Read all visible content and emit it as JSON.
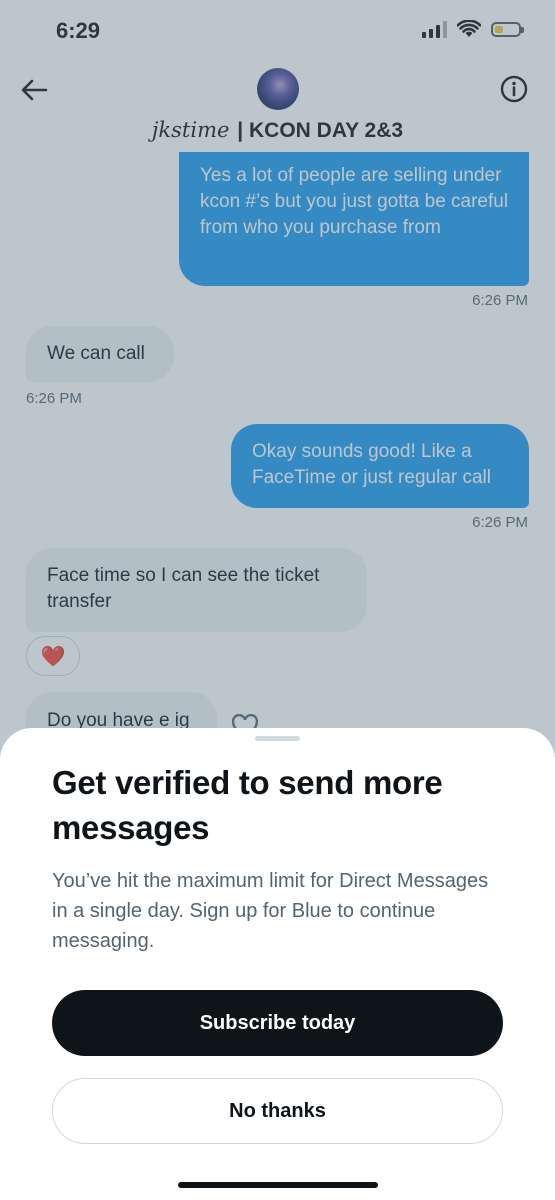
{
  "status_bar": {
    "time": "6:29"
  },
  "header": {
    "title_handle": "jkstime",
    "title_separator": "|",
    "title_name": "KCON DAY 2&3"
  },
  "messages": [
    {
      "direction": "sent",
      "text": "Yes a lot of people are selling under kcon #’s but you just gotta be careful from who you purchase from",
      "time": "6:26 PM"
    },
    {
      "direction": "received",
      "text": "We can call",
      "time": "6:26 PM"
    },
    {
      "direction": "sent",
      "text": "Okay sounds good! Like a FaceTime or just regular call",
      "time": "6:26 PM"
    },
    {
      "direction": "received",
      "text": "Face time so I can see the ticket transfer",
      "reaction": "❤️"
    },
    {
      "direction": "received",
      "text": "Do you have e ig"
    }
  ],
  "sheet": {
    "title": "Get verified to send more messages",
    "body": "You’ve hit the maximum limit for Direct Messages in a single day. Sign up for Blue to continue messaging.",
    "primary_button": "Subscribe today",
    "secondary_button": "No thanks"
  },
  "colors": {
    "sent_bubble": "#1d9bf0",
    "received_bubble": "#eff3f4",
    "primary_button": "#0f1419",
    "overlay": "rgba(91,112,131,0.4)"
  }
}
